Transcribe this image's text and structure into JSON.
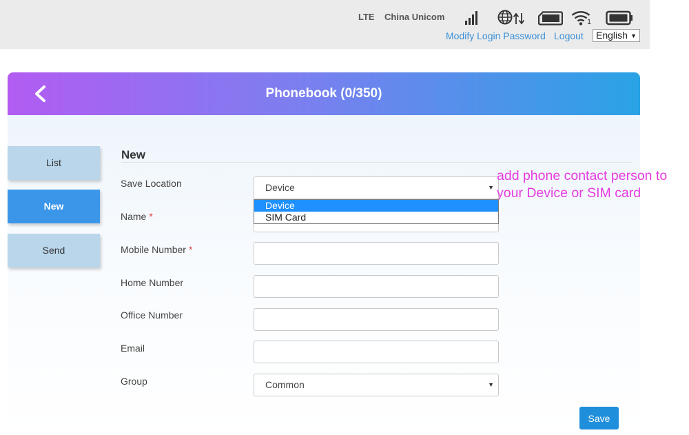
{
  "status": {
    "network_type": "LTE",
    "carrier": "China Unicom",
    "icons": [
      "signal-strength-icon",
      "internet-traffic-icon",
      "sim-card-icon",
      "wifi-icon",
      "battery-icon"
    ],
    "wifi_clients": "1"
  },
  "header_links": {
    "modify_password": "Modify Login Password",
    "logout": "Logout"
  },
  "language": {
    "selected": "English"
  },
  "panel": {
    "title": "Phonebook (0/350)"
  },
  "sidebar": {
    "tabs": [
      {
        "label": "List"
      },
      {
        "label": "New",
        "active": true
      },
      {
        "label": "Send"
      }
    ]
  },
  "form": {
    "section_title": "New",
    "fields": {
      "save_location": {
        "label": "Save Location",
        "value": "Device"
      },
      "name": {
        "label": "Name",
        "required_mark": "*",
        "value": ""
      },
      "mobile": {
        "label": "Mobile Number",
        "required_mark": "*",
        "value": ""
      },
      "home": {
        "label": "Home Number",
        "value": ""
      },
      "office": {
        "label": "Office Number",
        "value": ""
      },
      "email": {
        "label": "Email",
        "value": ""
      },
      "group": {
        "label": "Group",
        "value": "Common"
      }
    },
    "save_location_options": [
      "Device",
      "SIM Card"
    ],
    "save_label": "Save"
  },
  "annotation": "add phone contact person to your Device or SIM card",
  "colors": {
    "accent": "#3b96ea",
    "header_gradient_start": "#b25cf2",
    "header_gradient_end": "#2aa3e6",
    "annotation": "#e63be0"
  }
}
